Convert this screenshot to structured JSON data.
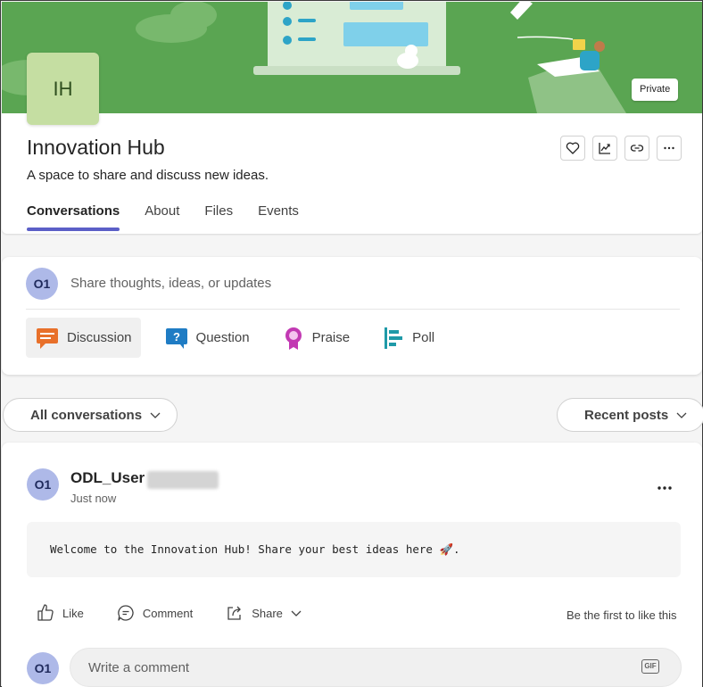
{
  "community": {
    "initials": "IH",
    "name": "Innovation Hub",
    "description": "A space to share and discuss new ideas.",
    "privacy": "Private"
  },
  "header_actions": [
    "favorite-icon",
    "analytics-icon",
    "link-icon",
    "more-icon"
  ],
  "tabs": [
    {
      "label": "Conversations",
      "active": true
    },
    {
      "label": "About",
      "active": false
    },
    {
      "label": "Files",
      "active": false
    },
    {
      "label": "Events",
      "active": false
    }
  ],
  "composer": {
    "user_initials": "O1",
    "placeholder": "Share thoughts, ideas, or updates",
    "post_types": [
      {
        "label": "Discussion",
        "icon": "discussion-icon",
        "color": "#e8702a"
      },
      {
        "label": "Question",
        "icon": "question-icon",
        "color": "#1f7cc4"
      },
      {
        "label": "Praise",
        "icon": "praise-icon",
        "color": "#c239b3"
      },
      {
        "label": "Poll",
        "icon": "poll-icon",
        "color": "#1f9aa8"
      }
    ]
  },
  "filters": {
    "conversations": "All conversations",
    "sort": "Recent posts"
  },
  "post": {
    "author_initials": "O1",
    "author": "ODL_User",
    "time": "Just now",
    "body": "Welcome to the Innovation Hub! Share your best ideas here 🚀.",
    "actions": {
      "like": "Like",
      "comment": "Comment",
      "share": "Share"
    },
    "like_summary": "Be the first to like this",
    "comment_placeholder": "Write a comment",
    "gif_label": "GIF"
  },
  "colors": {
    "banner": "#5aa552",
    "avatar_bg": "#c5dea2",
    "accent": "#5b5fc7",
    "user_avatar": "#aeb9e8"
  }
}
